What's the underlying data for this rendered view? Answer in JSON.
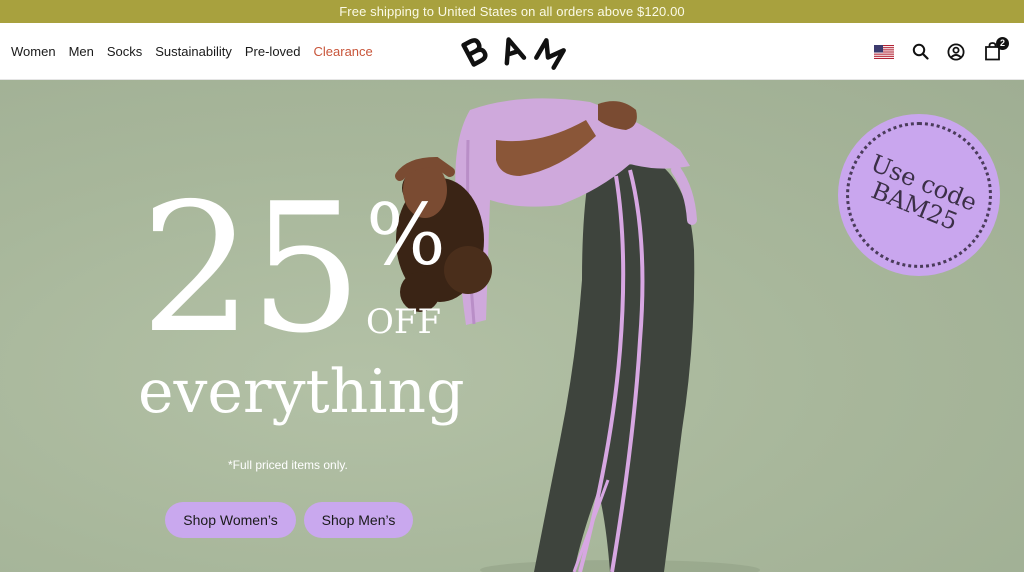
{
  "announcement": "Free shipping to United States on all orders above $120.00",
  "nav": {
    "items": [
      "Women",
      "Men",
      "Socks",
      "Sustainability",
      "Pre-loved",
      "Clearance"
    ]
  },
  "header": {
    "logo_letters": "B A M",
    "icons": [
      "us-flag-icon",
      "search-icon",
      "account-icon",
      "bag-icon"
    ],
    "cart_count": "2"
  },
  "hero": {
    "number": "25",
    "percent": "%",
    "off": "OFF",
    "headline": "everything",
    "disclaimer": "*Full priced items only.",
    "cta_women": "Shop Women’s",
    "cta_men": "Shop Men’s",
    "promo_line1": "Use code",
    "promo_line2": "BAM25"
  },
  "colors": {
    "announcement_bg": "#a8a13e",
    "clearance": "#c8553a",
    "cta_bg": "#c9a8ee",
    "hero_bg": "#a9b89c"
  }
}
